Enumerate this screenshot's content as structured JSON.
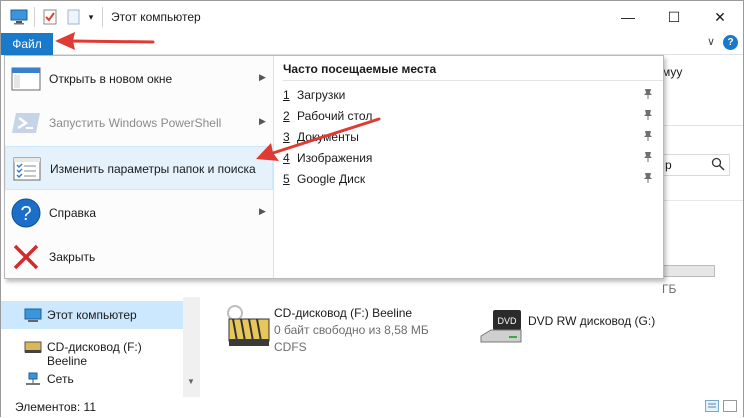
{
  "window": {
    "title": "Этот компьютер",
    "minimize_glyph": "—",
    "maximize_glyph": "☐",
    "close_glyph": "✕"
  },
  "ribbon": {
    "file_tab": "Файл",
    "collapse_glyph": "∨",
    "help_glyph": "?"
  },
  "file_menu": {
    "items": [
      {
        "label": "Открыть в новом окне",
        "has_submenu": true,
        "icon": "new-window-icon",
        "enabled": true
      },
      {
        "label": "Запустить Windows PowerShell",
        "has_submenu": true,
        "icon": "powershell-icon",
        "enabled": false
      },
      {
        "label": "Изменить параметры папок и поиска",
        "has_submenu": false,
        "icon": "folder-options-icon",
        "enabled": true
      },
      {
        "label": "Справка",
        "has_submenu": true,
        "icon": "help-icon",
        "enabled": true
      },
      {
        "label": "Закрыть",
        "has_submenu": false,
        "icon": "close-x-icon",
        "enabled": true
      }
    ],
    "frequent": {
      "title": "Часто посещаемые места",
      "items": [
        {
          "num": "1",
          "label": "Загрузки"
        },
        {
          "num": "2",
          "label": "Рабочий стол"
        },
        {
          "num": "3",
          "label": "Документы"
        },
        {
          "num": "4",
          "label": "Изображения"
        },
        {
          "num": "5",
          "label": "Google Диск"
        }
      ]
    }
  },
  "background": {
    "ribbon_partial": "муу",
    "search_partial": "р",
    "size_partial": "ГБ"
  },
  "nav": {
    "items": [
      {
        "label": "Этот компьютер",
        "icon": "computer-icon",
        "selected": true
      },
      {
        "label": "CD-дисковод (F:) Beeline",
        "icon": "cd-drive-icon",
        "selected": false
      },
      {
        "label": "Сеть",
        "icon": "network-icon",
        "selected": false
      }
    ]
  },
  "content": {
    "drives": [
      {
        "name": "CD-дисковод (F:) Beeline",
        "free": "0 байт свободно из 8,58 МБ",
        "fs": "CDFS",
        "icon": "cd-drive-icon"
      },
      {
        "name": "DVD RW дисковод (G:)",
        "icon": "dvd-drive-icon"
      }
    ]
  },
  "status": {
    "items_count": "Элементов: 11"
  },
  "colors": {
    "accent": "#1979ca",
    "arrow": "#e03b33",
    "selection": "#cce8ff"
  }
}
